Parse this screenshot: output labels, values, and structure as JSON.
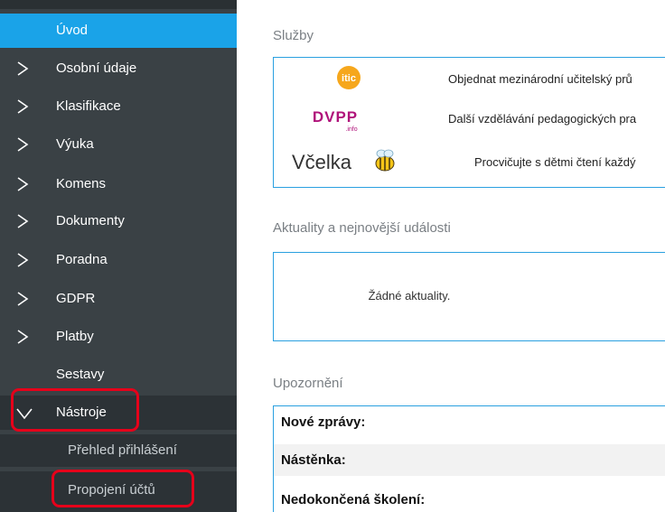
{
  "sidebar": {
    "items": [
      {
        "label": "Úvod",
        "state": "active",
        "chevron": false
      },
      {
        "label": "Osobní údaje",
        "state": "collapsed",
        "chevron": true
      },
      {
        "label": "Klasifikace",
        "state": "collapsed",
        "chevron": true
      },
      {
        "label": "Výuka",
        "state": "collapsed",
        "chevron": true
      },
      {
        "label": "Komens",
        "state": "collapsed",
        "chevron": true
      },
      {
        "label": "Dokumenty",
        "state": "collapsed",
        "chevron": true
      },
      {
        "label": "Poradna",
        "state": "collapsed",
        "chevron": true
      },
      {
        "label": "GDPR",
        "state": "collapsed",
        "chevron": true
      },
      {
        "label": "Platby",
        "state": "collapsed",
        "chevron": true
      },
      {
        "label": "Sestavy",
        "state": "plain",
        "chevron": false
      },
      {
        "label": "Nástroje",
        "state": "expanded",
        "chevron": true
      }
    ],
    "subitems": [
      {
        "label": "Přehled přihlášení"
      },
      {
        "label": "Propojení účtů"
      }
    ],
    "colors": {
      "background": "#3a4145",
      "active": "#1aa3e8",
      "annotation": "#e6001a"
    }
  },
  "services": {
    "title": "Služby",
    "rows": [
      {
        "logo": "itic-logo",
        "logo_text": "itic",
        "text": "Objednat mezinárodní učitelský prů"
      },
      {
        "logo": "dvpp-logo",
        "logo_text": "DVPP",
        "logo_subtext": ".info",
        "text": "Další vzdělávání pedagogických pra"
      },
      {
        "logo": "vcelka-logo",
        "logo_text": "Včelka",
        "text": "Procvičujte s dětmi čtení každý"
      }
    ]
  },
  "news": {
    "title": "Aktuality a nejnovější události",
    "empty": "Žádné aktuality."
  },
  "alerts": {
    "title": "Upozornění",
    "rows": [
      {
        "label": "Nové zprávy:"
      },
      {
        "label": "Nástěnka:"
      },
      {
        "label": "Nedokončená školení:"
      }
    ]
  }
}
